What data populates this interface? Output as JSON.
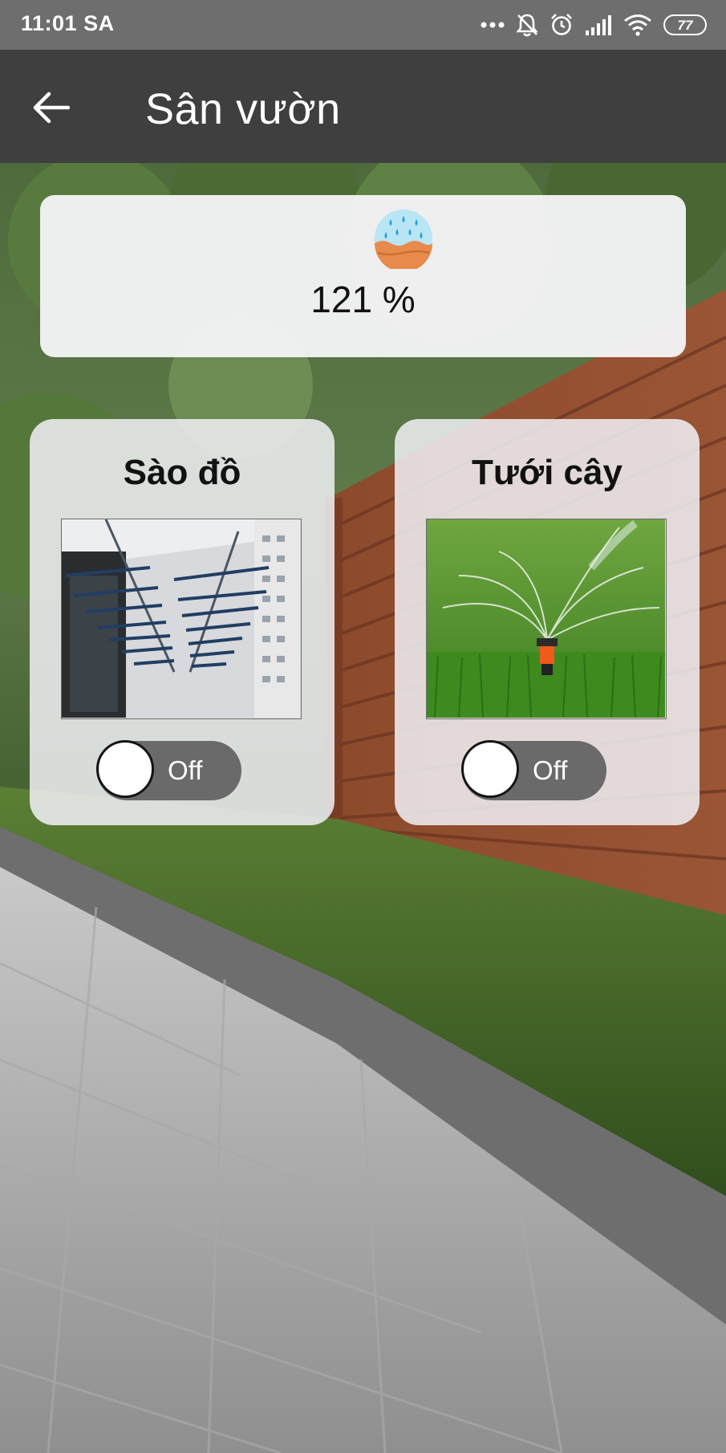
{
  "status_bar": {
    "time": "11:01 SA",
    "battery": "77",
    "icons": [
      "more-dots-icon",
      "mute-bell-icon",
      "alarm-icon",
      "signal-icon",
      "wifi-icon",
      "battery-icon"
    ]
  },
  "app_bar": {
    "back_icon": "back-arrow-icon",
    "title": "Sân vườn"
  },
  "humidity": {
    "icon": "soil-moisture-icon",
    "value": "121 %"
  },
  "devices": [
    {
      "title": "Sào đồ",
      "image": "clothes-drying-rack-photo",
      "toggle_label": "Off",
      "toggle_on": false
    },
    {
      "title": "Tưới cây",
      "image": "lawn-sprinkler-photo",
      "toggle_label": "Off",
      "toggle_on": false
    }
  ],
  "colors": {
    "status_bar": "#6e6e6e",
    "app_bar": "#3f3f3f",
    "toggle_track": "#6a6a6a",
    "card": "#f2f2f4"
  }
}
